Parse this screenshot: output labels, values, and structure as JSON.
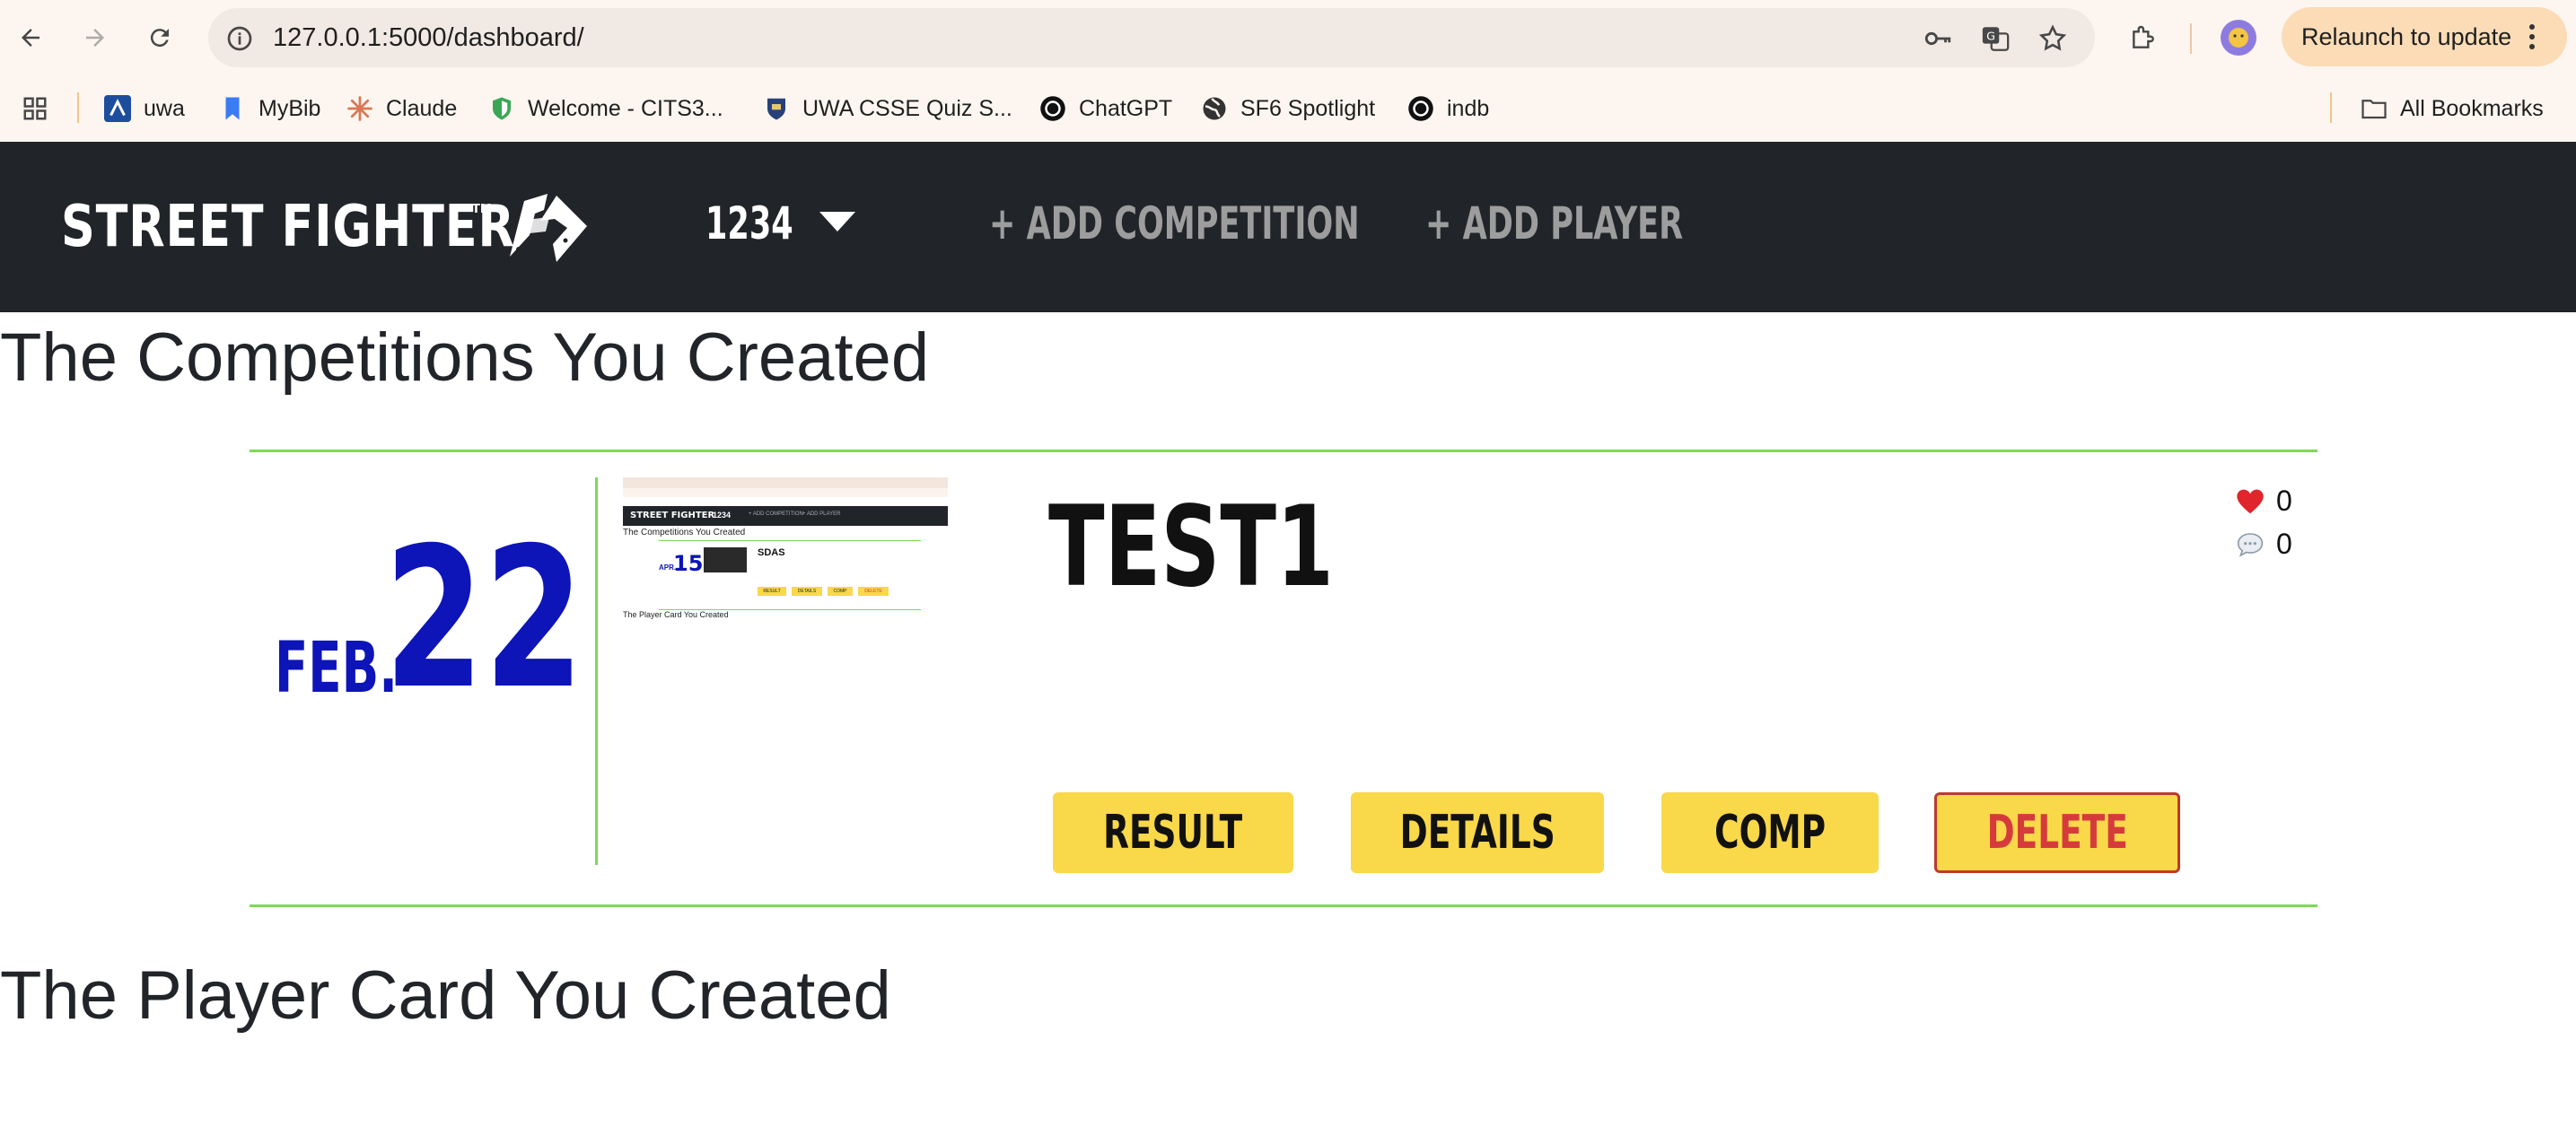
{
  "browser": {
    "url": "127.0.0.1:5000/dashboard/",
    "relaunch_label": "Relaunch to update",
    "bookmarks": [
      {
        "label": "uwa",
        "icon": "uwa-logo-icon"
      },
      {
        "label": "MyBib",
        "icon": "bookmark-icon"
      },
      {
        "label": "Claude",
        "icon": "claude-icon"
      },
      {
        "label": "Welcome - CITS3...",
        "icon": "shield-icon"
      },
      {
        "label": "UWA CSSE Quiz S...",
        "icon": "crest-icon"
      },
      {
        "label": "ChatGPT",
        "icon": "openai-icon"
      },
      {
        "label": "SF6 Spotlight",
        "icon": "globe-icon"
      },
      {
        "label": "indb",
        "icon": "openai-icon"
      }
    ],
    "all_bookmarks_label": "All Bookmarks"
  },
  "nav": {
    "logo_text": "STREET FIGHTER",
    "logo_tm": "TM",
    "user_label": "1234",
    "add_competition_label": "+ ADD COMPETITION",
    "add_player_label": "+ ADD PLAYER"
  },
  "sections": {
    "competitions_title": "The Competitions You Created",
    "player_cards_title": "The Player Card You Created"
  },
  "competitions": [
    {
      "month": "FEB.",
      "day": "22",
      "title": "TEST1",
      "likes": "0",
      "comments": "0",
      "thumbnail": {
        "section_title": "The Competitions You Created",
        "month": "APR.",
        "day": "15",
        "title": "SDAS",
        "buttons": [
          "RESULT",
          "DETAILS",
          "COMP",
          "DELETE"
        ],
        "footer_title": "The Player Card You Created",
        "nav_user": "1234",
        "nav_links": [
          "+ ADD COMPETITION",
          "+ ADD PLAYER"
        ]
      },
      "buttons": {
        "result": "RESULT",
        "details": "DETAILS",
        "comp": "COMP",
        "delete": "DELETE"
      }
    }
  ],
  "colors": {
    "navbar_bg": "#212529",
    "accent_green": "#7ed957",
    "date_blue": "#0d14b8",
    "button_yellow": "#f9d849",
    "delete_red": "#d63b3b"
  }
}
